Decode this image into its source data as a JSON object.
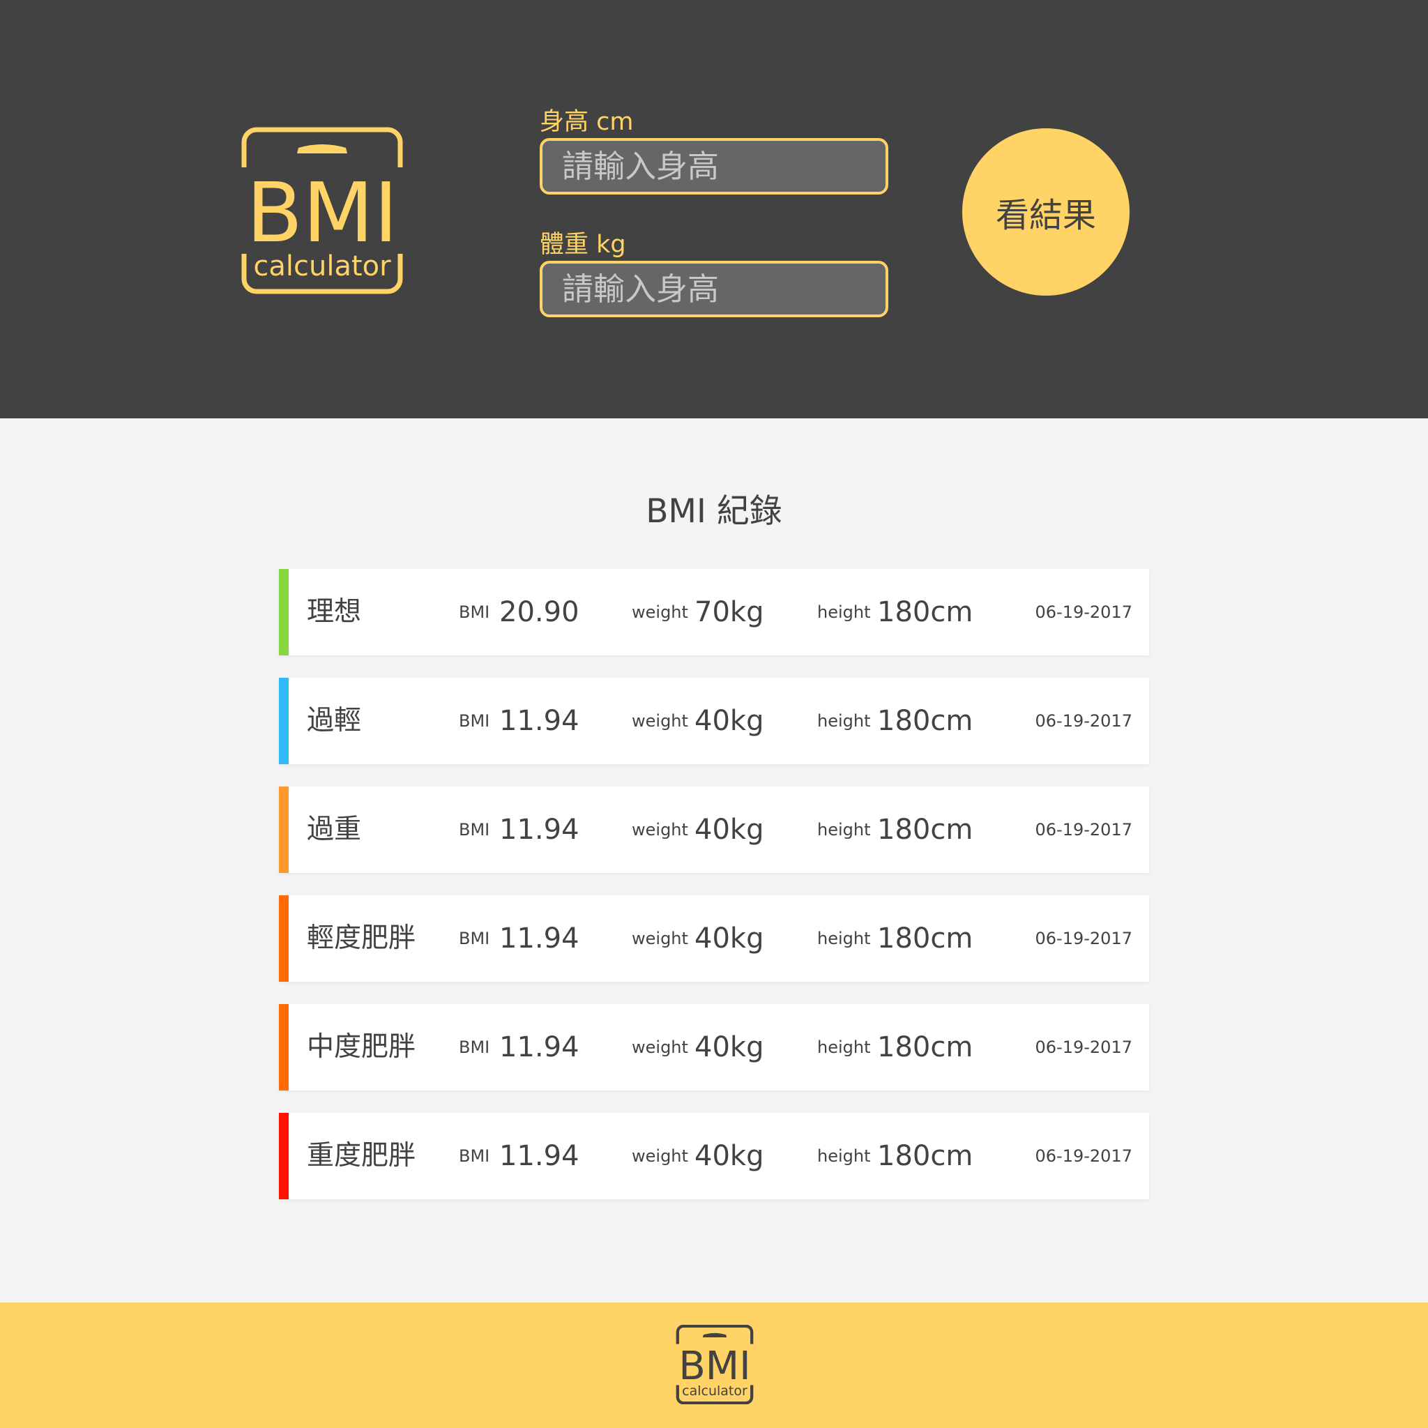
{
  "colors": {
    "brand_yellow": "#ffd366",
    "dark_bg": "#424242",
    "light_bg": "#f4f4f4",
    "ideal": "#86d73f",
    "underweight": "#31baf9",
    "overweight": "#ff982d",
    "mild_obese": "#ff6c03",
    "moderate_obese": "#ff6c03",
    "severe_obese": "#ff1200"
  },
  "logo": {
    "main_text": "BMI",
    "sub_text": "calculator",
    "icon": "bmi-scale-icon"
  },
  "form": {
    "height_label": "身高 cm",
    "height_placeholder": "請輸入身高",
    "weight_label": "體重 kg",
    "weight_placeholder": "請輸入身高",
    "submit_label": "看結果"
  },
  "records": {
    "title": "BMI 紀錄",
    "bmi_label": "BMI",
    "weight_label": "weight",
    "height_label": "height",
    "items": [
      {
        "status": "理想",
        "bmi": "20.90",
        "weight": "70kg",
        "height": "180cm",
        "date": "06-19-2017",
        "color": "#86d73f"
      },
      {
        "status": "過輕",
        "bmi": "11.94",
        "weight": "40kg",
        "height": "180cm",
        "date": "06-19-2017",
        "color": "#31baf9"
      },
      {
        "status": "過重",
        "bmi": "11.94",
        "weight": "40kg",
        "height": "180cm",
        "date": "06-19-2017",
        "color": "#ff982d"
      },
      {
        "status": "輕度肥胖",
        "bmi": "11.94",
        "weight": "40kg",
        "height": "180cm",
        "date": "06-19-2017",
        "color": "#ff6c03"
      },
      {
        "status": "中度肥胖",
        "bmi": "11.94",
        "weight": "40kg",
        "height": "180cm",
        "date": "06-19-2017",
        "color": "#ff6c03"
      },
      {
        "status": "重度肥胖",
        "bmi": "11.94",
        "weight": "40kg",
        "height": "180cm",
        "date": "06-19-2017",
        "color": "#ff1200"
      }
    ]
  }
}
